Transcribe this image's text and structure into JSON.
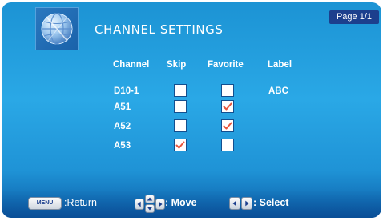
{
  "header": {
    "title": "CHANNEL SETTINGS",
    "page": "Page 1/1",
    "logo_icon": "globe-icon"
  },
  "table": {
    "columns": [
      "Channel",
      "Skip",
      "Favorite",
      "Label"
    ],
    "rows": [
      {
        "channel": "D10-1",
        "skip": false,
        "favorite": false,
        "label": "ABC"
      },
      {
        "channel": "A51",
        "skip": false,
        "favorite": true,
        "label": ""
      },
      {
        "channel": "A52",
        "skip": false,
        "favorite": true,
        "label": ""
      },
      {
        "channel": "A53",
        "skip": true,
        "favorite": false,
        "label": ""
      }
    ]
  },
  "footer": {
    "menu_key": "MENU",
    "return_label": ":Return",
    "move_label": ": Move",
    "select_label": ": Select"
  },
  "colors": {
    "background": "#1c93d4",
    "page_tag": "#1c3f8d",
    "check": "#e8553c"
  }
}
